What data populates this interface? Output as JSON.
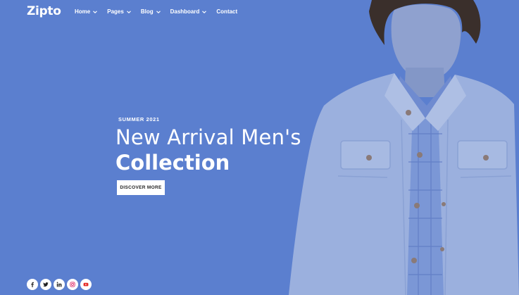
{
  "brand": {
    "logo_text": "Zipto"
  },
  "nav": {
    "items": [
      {
        "label": "Home",
        "has_dropdown": true
      },
      {
        "label": "Pages",
        "has_dropdown": true
      },
      {
        "label": "Blog",
        "has_dropdown": true
      },
      {
        "label": "Dashboard",
        "has_dropdown": true
      },
      {
        "label": "Contact",
        "has_dropdown": false
      }
    ]
  },
  "hero": {
    "eyebrow": "SUMMER 2021",
    "headline": "New Arrival Men's",
    "subheadline": "Collection",
    "cta_label": "DISCOVER MORE"
  },
  "social": {
    "icons": [
      "facebook-icon",
      "twitter-icon",
      "linkedin-icon",
      "instagram-icon",
      "youtube-icon"
    ]
  },
  "colors": {
    "background": "#5b7fcf",
    "text": "#ffffff",
    "button_bg": "#ffffff",
    "button_text": "#222222",
    "instagram": "#e1306c",
    "youtube": "#e52d27"
  }
}
